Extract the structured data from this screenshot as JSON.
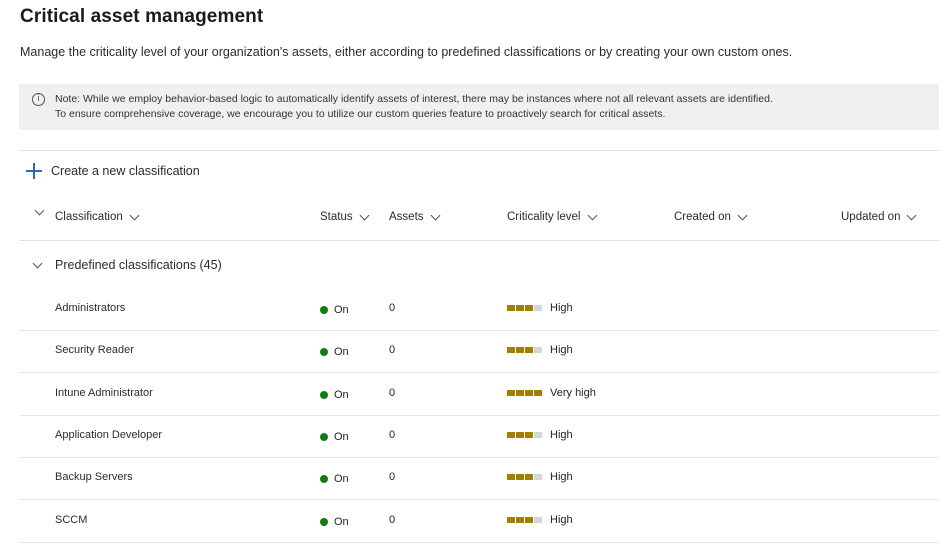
{
  "header": {
    "title": "Critical asset management",
    "description": "Manage the criticality level of your organization's assets, either according to predefined classifications or by creating your own custom ones."
  },
  "note": {
    "line1": "Note: While we employ behavior-based logic to automatically identify assets of interest, there may be instances where not all relevant assets are identified.",
    "line2": "To ensure comprehensive coverage, we encourage you to utilize our custom queries feature to proactively search for critical assets."
  },
  "toolbar": {
    "create_label": "Create a new classification"
  },
  "columns": {
    "classification": "Classification",
    "status": "Status",
    "assets": "Assets",
    "criticality": "Criticality level",
    "created": "Created on",
    "updated": "Updated on"
  },
  "group": {
    "label": "Predefined classifications (45)"
  },
  "rows": [
    {
      "name": "Administrators",
      "status": "On",
      "assets": "0",
      "criticality": "High",
      "level": 3
    },
    {
      "name": "Security Reader",
      "status": "On",
      "assets": "0",
      "criticality": "High",
      "level": 3
    },
    {
      "name": "Intune Administrator",
      "status": "On",
      "assets": "0",
      "criticality": "Very high",
      "level": 4
    },
    {
      "name": "Application Developer",
      "status": "On",
      "assets": "0",
      "criticality": "High",
      "level": 3
    },
    {
      "name": "Backup Servers",
      "status": "On",
      "assets": "0",
      "criticality": "High",
      "level": 3
    },
    {
      "name": "SCCM",
      "status": "On",
      "assets": "0",
      "criticality": "High",
      "level": 3
    }
  ],
  "colors": {
    "status_on": "#107c10",
    "criticality_bar": "#a37f00",
    "accent": "#2a6ab8"
  }
}
